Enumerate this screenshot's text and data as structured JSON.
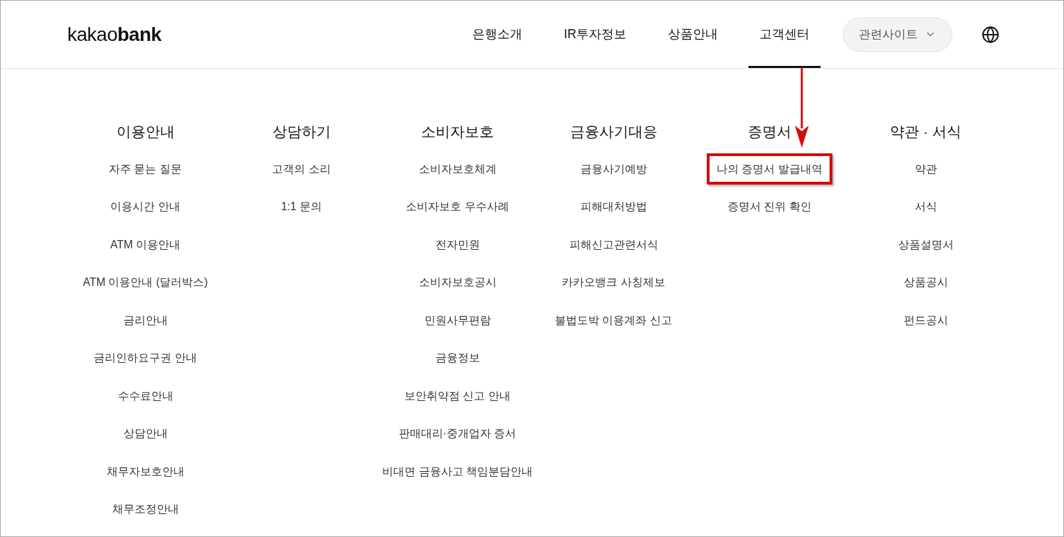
{
  "header": {
    "logo": "kakao**bank**",
    "nav": [
      {
        "label": "은행소개",
        "selected": false
      },
      {
        "label": "IR투자정보",
        "selected": false
      },
      {
        "label": "상품안내",
        "selected": false
      },
      {
        "label": "고객센터",
        "selected": true
      }
    ],
    "related_sites": {
      "label": "관련사이트"
    }
  },
  "menu": [
    {
      "title": "이용안내",
      "items": [
        {
          "label": "자주 묻는 질문",
          "highlighted": false
        },
        {
          "label": "이용시간 안내",
          "highlighted": false
        },
        {
          "label": "ATM 이용안내",
          "highlighted": false
        },
        {
          "label": "ATM 이용안내 (달러박스)",
          "highlighted": false
        },
        {
          "label": "금리안내",
          "highlighted": false
        },
        {
          "label": "금리인하요구권 안내",
          "highlighted": false
        },
        {
          "label": "수수료안내",
          "highlighted": false
        },
        {
          "label": "상담안내",
          "highlighted": false
        },
        {
          "label": "채무자보호안내",
          "highlighted": false
        },
        {
          "label": "채무조정안내",
          "highlighted": false
        }
      ]
    },
    {
      "title": "상담하기",
      "items": [
        {
          "label": "고객의 소리",
          "highlighted": false
        },
        {
          "label": "1:1 문의",
          "highlighted": false
        }
      ]
    },
    {
      "title": "소비자보호",
      "items": [
        {
          "label": "소비자보호체계",
          "highlighted": false
        },
        {
          "label": "소비자보호 우수사례",
          "highlighted": false
        },
        {
          "label": "전자민원",
          "highlighted": false
        },
        {
          "label": "소비자보호공시",
          "highlighted": false
        },
        {
          "label": "민원사무편람",
          "highlighted": false
        },
        {
          "label": "금융정보",
          "highlighted": false
        },
        {
          "label": "보안취약점 신고 안내",
          "highlighted": false
        },
        {
          "label": "판매대리·중개업자 증서",
          "highlighted": false
        },
        {
          "label": "비대면 금융사고 책임분담안내",
          "highlighted": false
        }
      ]
    },
    {
      "title": "금융사기대응",
      "items": [
        {
          "label": "금융사기예방",
          "highlighted": false
        },
        {
          "label": "피해대처방법",
          "highlighted": false
        },
        {
          "label": "피해신고관련서식",
          "highlighted": false
        },
        {
          "label": "카카오뱅크 사칭제보",
          "highlighted": false
        },
        {
          "label": "불법도박 이용계좌 신고",
          "highlighted": false
        }
      ]
    },
    {
      "title": "증명서",
      "items": [
        {
          "label": "나의 증명서 발급내역",
          "highlighted": true
        },
        {
          "label": "증명서 진위 확인",
          "highlighted": false
        }
      ]
    },
    {
      "title": "약관 · 서식",
      "items": [
        {
          "label": "약관",
          "highlighted": false
        },
        {
          "label": "서식",
          "highlighted": false
        },
        {
          "label": "상품설명서",
          "highlighted": false
        },
        {
          "label": "상품공시",
          "highlighted": false
        },
        {
          "label": "펀드공시",
          "highlighted": false
        }
      ]
    }
  ]
}
